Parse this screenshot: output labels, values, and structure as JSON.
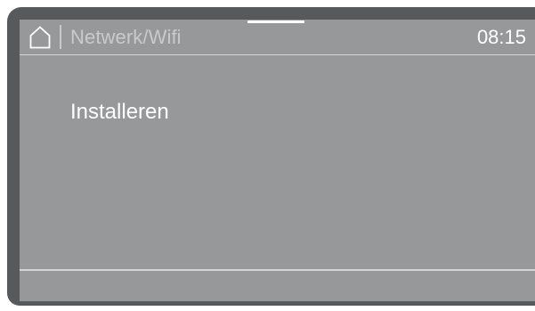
{
  "header": {
    "home_icon": "home-icon",
    "title": "Netwerk/Wifi",
    "time": "08:15"
  },
  "menu": {
    "items": [
      {
        "label": "Installeren"
      }
    ]
  },
  "colors": {
    "frame": "#58595b",
    "screen": "#97989a",
    "text": "#ffffff",
    "title_text": "#c9cacc",
    "divider_line": "#d4d4d5"
  }
}
